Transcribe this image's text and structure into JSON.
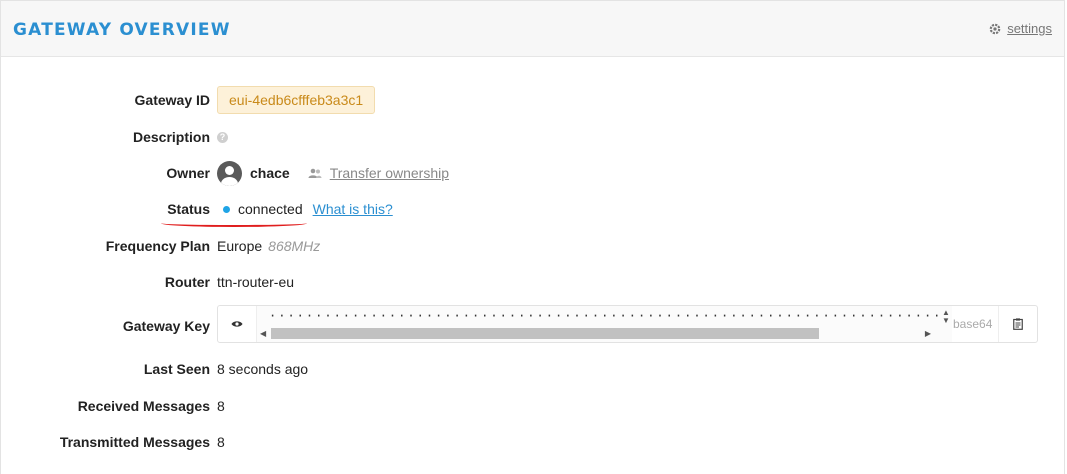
{
  "header": {
    "title": "GATEWAY OVERVIEW",
    "settings_label": "settings",
    "settings_icon": "gear-icon"
  },
  "fields": {
    "gateway_id": {
      "label": "Gateway ID",
      "value": "eui-4edb6cfffeb3a3c1"
    },
    "description": {
      "label": "Description",
      "help": "?"
    },
    "owner": {
      "label": "Owner",
      "name": "chace",
      "transfer_label": "Transfer ownership"
    },
    "status": {
      "label": "Status",
      "value": "connected",
      "help_link": "What is this?",
      "indicator_color": "#1fa4e6"
    },
    "frequency_plan": {
      "label": "Frequency Plan",
      "value": "Europe",
      "detail": "868MHz"
    },
    "router": {
      "label": "Router",
      "value": "ttn-router-eu"
    },
    "gateway_key": {
      "label": "Gateway Key",
      "masked": "·······························································································",
      "encoding": "base64"
    },
    "last_seen": {
      "label": "Last Seen",
      "value": "8 seconds ago"
    },
    "received_messages": {
      "label": "Received Messages",
      "value": "8"
    },
    "transmitted_messages": {
      "label": "Transmitted Messages",
      "value": "8"
    }
  },
  "colors": {
    "accent": "#2b8fd1",
    "annotation": "#e01e1e",
    "id_badge_text": "#c98a1a"
  }
}
